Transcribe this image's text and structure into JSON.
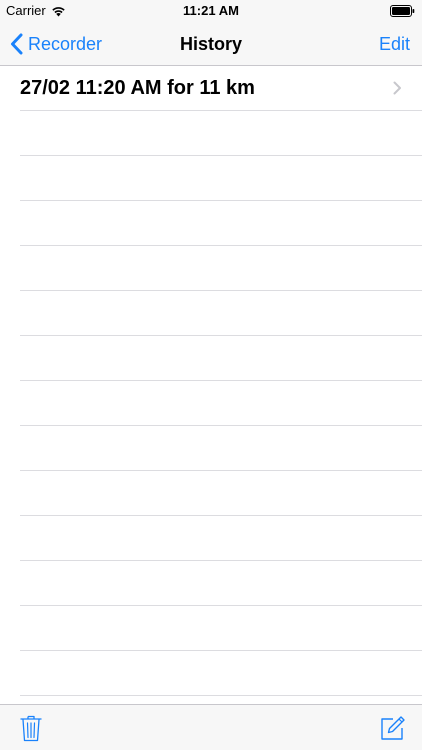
{
  "status_bar": {
    "carrier": "Carrier",
    "time": "11:21 AM",
    "wifi_icon": "wifi-icon",
    "battery_icon": "battery-icon"
  },
  "nav_bar": {
    "back_label": "Recorder",
    "back_icon": "chevron-left-icon",
    "title": "History",
    "edit_label": "Edit"
  },
  "history": {
    "items": [
      {
        "label": "27/02 11:20 AM for 11 km",
        "accessory_icon": "chevron-right-icon"
      }
    ]
  },
  "toolbar": {
    "trash_icon": "trash-icon",
    "compose_icon": "compose-icon"
  },
  "colors": {
    "accent": "#1a82fb",
    "bar_background": "#f7f7f7",
    "separator": "#dcdce0",
    "chevron": "#c7c7cc"
  }
}
